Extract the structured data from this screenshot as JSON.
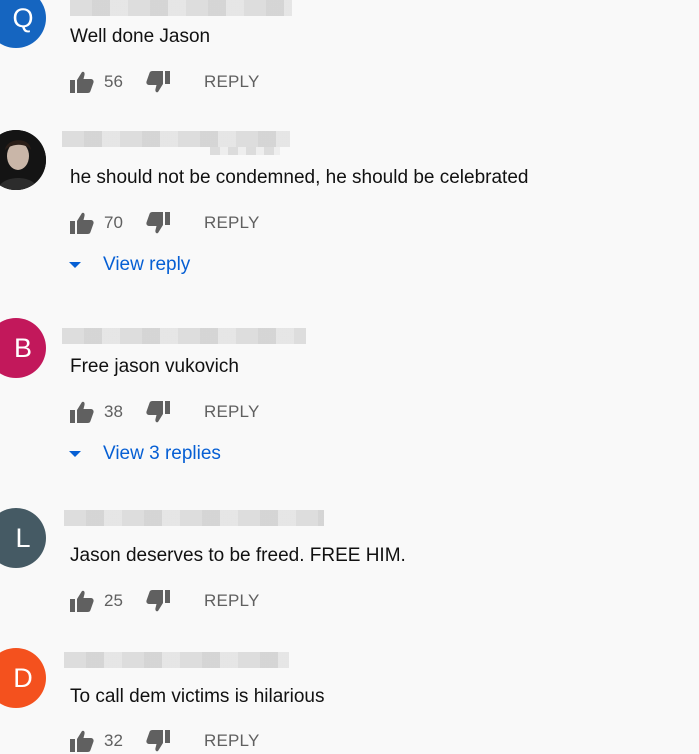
{
  "comments": [
    {
      "avatar_letter": "Q",
      "avatar_color": "#1565c0",
      "text": "Well done Jason",
      "likes": "56",
      "reply_label": "REPLY"
    },
    {
      "avatar_letter": "",
      "avatar_color": "#1a1a1a",
      "text": "he should not be condemned, he should be celebrated",
      "likes": "70",
      "reply_label": "REPLY",
      "view_replies": "View reply"
    },
    {
      "avatar_letter": "B",
      "avatar_color": "#c2185b",
      "text": "Free jason vukovich",
      "likes": "38",
      "reply_label": "REPLY",
      "view_replies": "View 3 replies"
    },
    {
      "avatar_letter": "L",
      "avatar_color": "#455a64",
      "text": "Jason deserves to be freed. FREE HIM.",
      "likes": "25",
      "reply_label": "REPLY"
    },
    {
      "avatar_letter": "D",
      "avatar_color": "#f4511e",
      "text": "To call dem victims is hilarious",
      "likes": "32",
      "reply_label": "REPLY"
    }
  ]
}
